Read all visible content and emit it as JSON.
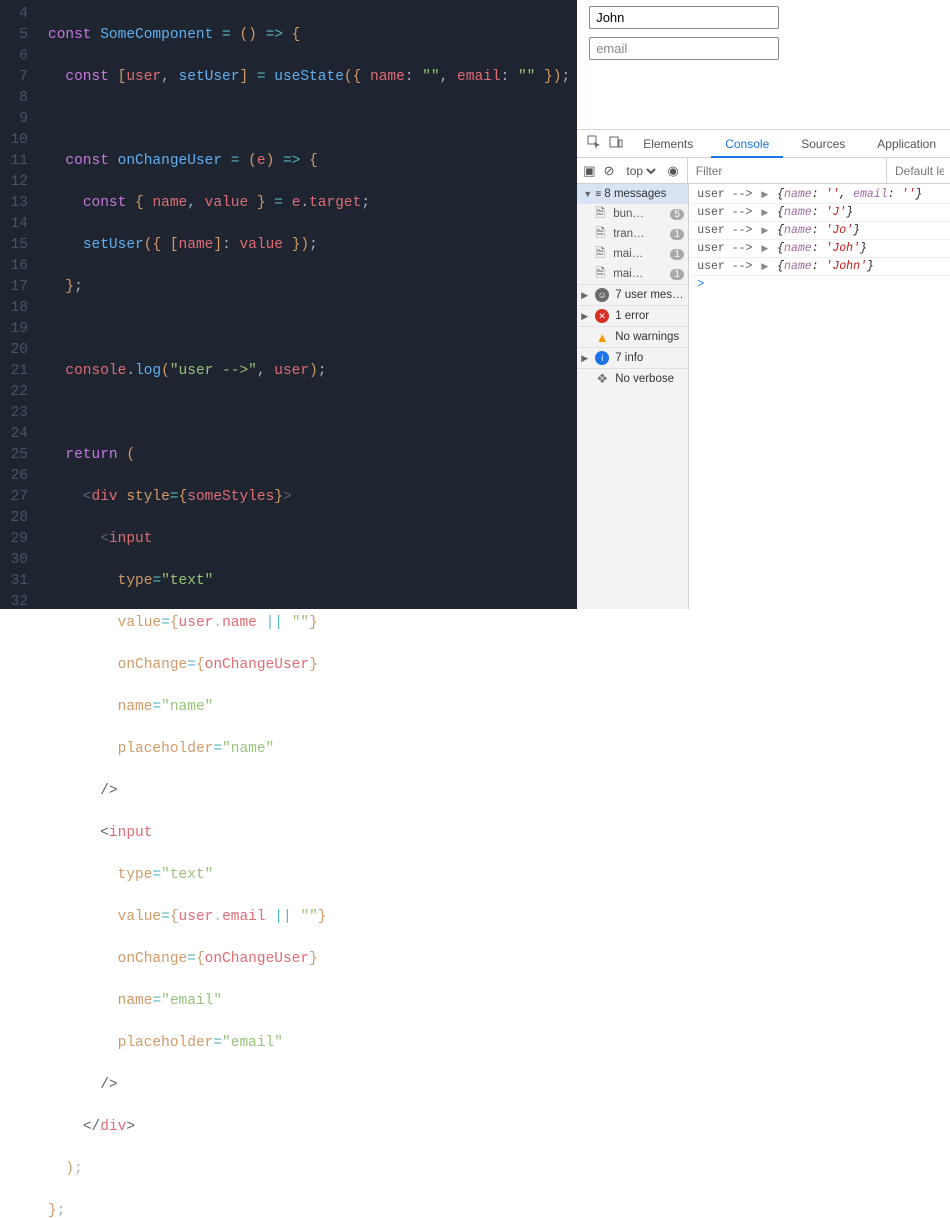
{
  "editor": {
    "startLine": 4
  },
  "preview": {
    "name_value": "John",
    "name_placeholder": "name",
    "email_value": "",
    "email_placeholder": "email"
  },
  "devtools": {
    "tabs": [
      "Elements",
      "Console",
      "Sources",
      "Application"
    ],
    "activeTab": "Console",
    "toolbar": {
      "context": "top",
      "filter_placeholder": "Filter",
      "levels_label": "Default lev"
    },
    "sidebar": {
      "messages_header": "8 messages",
      "files": [
        {
          "label": "bun…",
          "count": "5"
        },
        {
          "label": "tran…",
          "count": "1"
        },
        {
          "label": "mai…",
          "count": "1"
        },
        {
          "label": "mai…",
          "count": "1"
        }
      ],
      "groups": [
        {
          "icon": "user",
          "label": "7 user mes…",
          "caret": true
        },
        {
          "icon": "err",
          "label": "1 error",
          "caret": true
        },
        {
          "icon": "warn",
          "label": "No warnings",
          "caret": false
        },
        {
          "icon": "info",
          "label": "7 info",
          "caret": true
        },
        {
          "icon": "verb",
          "label": "No verbose",
          "caret": false
        }
      ]
    },
    "logs": [
      {
        "prefix": "user -->",
        "body": "{name: '', email: ''}"
      },
      {
        "prefix": "user -->",
        "body": "{name: 'J'}"
      },
      {
        "prefix": "user -->",
        "body": "{name: 'Jo'}"
      },
      {
        "prefix": "user -->",
        "body": "{name: 'Joh'}"
      },
      {
        "prefix": "user -->",
        "body": "{name: 'John'}"
      }
    ]
  }
}
